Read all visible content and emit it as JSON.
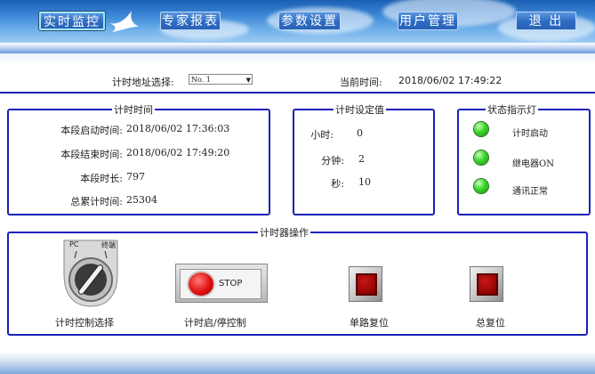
{
  "nav": {
    "items": [
      "实时监控",
      "专家报表",
      "参数设置",
      "用户管理",
      "退  出"
    ],
    "active": 0
  },
  "header": {
    "address_label": "计时地址选择:",
    "address_value": "No. 1",
    "current_time_label": "当前时间:",
    "current_time_value": "2018/06/02  17:49:22"
  },
  "timing_panel": {
    "title": "计时时间",
    "rows": [
      {
        "label": "本段启动时间:",
        "value": "2018/06/02 17:36:03"
      },
      {
        "label": "本段结束时间:",
        "value": "2018/06/02 17:49:20"
      },
      {
        "label": "本段时长:",
        "value": "797"
      },
      {
        "label": "总累计时间:",
        "value": "25304"
      }
    ]
  },
  "settings_panel": {
    "title": "计时设定值",
    "rows": [
      {
        "label": "小时:",
        "value": "0"
      },
      {
        "label": "分钟:",
        "value": "2"
      },
      {
        "label": "秒:",
        "value": "10"
      }
    ]
  },
  "status_panel": {
    "title": "状态指示灯",
    "items": [
      {
        "label": "计时启动",
        "color": "#2fd11f"
      },
      {
        "label": "继电器ON",
        "color": "#2fd11f"
      },
      {
        "label": "通讯正常",
        "color": "#2fd11f"
      }
    ]
  },
  "ops_panel": {
    "title": "计时器操作",
    "selector_left": "PC",
    "selector_right": "终端",
    "selector_label": "计时控制选择",
    "startstop_text": "STOP",
    "startstop_label": "计时启/停控制",
    "single_reset_label": "单路复位",
    "total_reset_label": "总复位"
  },
  "colors": {
    "panel_border": "#1b22b7",
    "banner_top": "#1a5fb4",
    "led_green": "#2fd11f",
    "button_red": "#a00000"
  }
}
